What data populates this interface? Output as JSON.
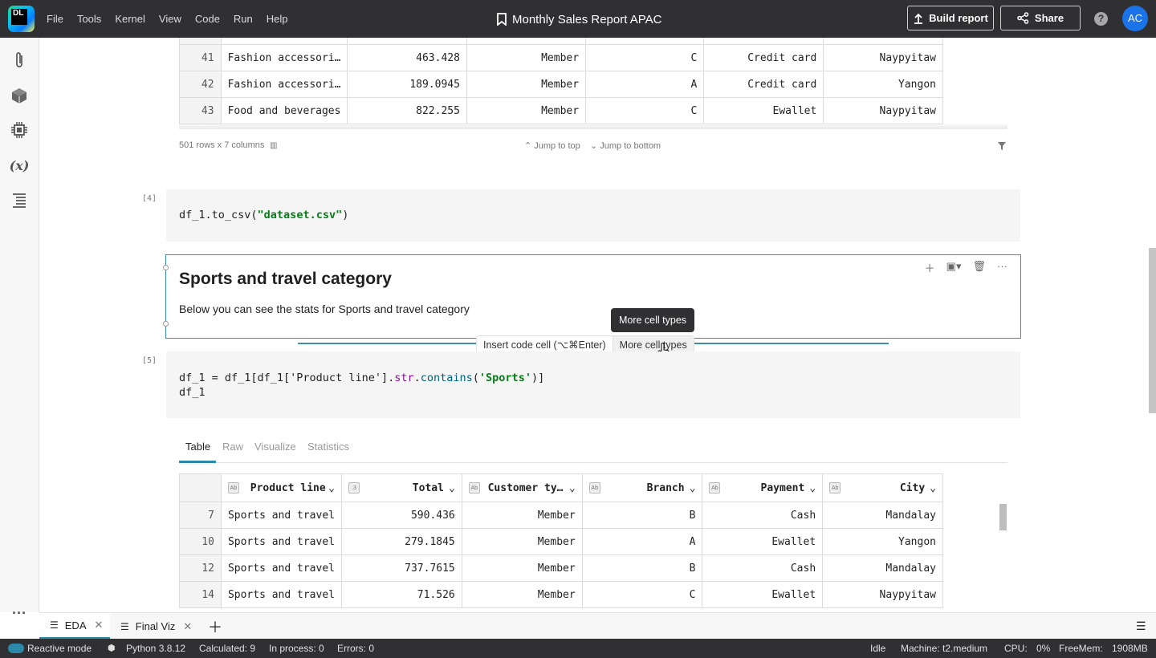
{
  "menu": [
    "File",
    "Tools",
    "Kernel",
    "View",
    "Code",
    "Run",
    "Help"
  ],
  "logo_text": "DL",
  "doc_title": "Monthly Sales Report APAC",
  "toolbar": {
    "build_label": "Build report",
    "share_label": "Share",
    "avatar": "AC",
    "help": "?"
  },
  "top_table": {
    "rows": [
      {
        "idx": "41",
        "product": "Fashion accessori…",
        "total": "463.428",
        "customer": "Member",
        "branch": "C",
        "payment": "Credit card",
        "city": "Naypyitaw"
      },
      {
        "idx": "42",
        "product": "Fashion accessori…",
        "total": "189.0945",
        "customer": "Member",
        "branch": "A",
        "payment": "Credit card",
        "city": "Yangon"
      },
      {
        "idx": "43",
        "product": "Food and beverages",
        "total": "822.255",
        "customer": "Member",
        "branch": "C",
        "payment": "Ewallet",
        "city": "Naypyitaw"
      }
    ],
    "summary": "501 rows x 7 columns",
    "jump_top": "Jump to top",
    "jump_bottom": "Jump to bottom"
  },
  "cell4": {
    "num": "[4]",
    "code_prefix": "df_1.to_csv(",
    "code_str": "\"dataset.csv\"",
    "code_suffix": ")"
  },
  "md_cell": {
    "heading": "Sports and travel category",
    "body": "Below you can see the stats for Sports and travel category"
  },
  "insert": {
    "code_label": "Insert code cell (⌥⌘Enter)",
    "more_label": "More cell types",
    "tooltip": "More cell types"
  },
  "cell5": {
    "num": "[5]",
    "line1_a": "df_1 = df_1[df_1['Product line'].",
    "line1_fn": "str",
    "line1_dot": ".",
    "line1_call": "contains",
    "line1_paren": "(",
    "line1_str": "'Sports'",
    "line1_end": ")]",
    "line2": "df_1"
  },
  "output_tabs": [
    "Table",
    "Raw",
    "Visualize",
    "Statistics"
  ],
  "bottom_table": {
    "headers": [
      {
        "type": "Ab",
        "label": "Product line"
      },
      {
        "type": ".3",
        "label": "Total"
      },
      {
        "type": "Ab",
        "label": "Customer ty…"
      },
      {
        "type": "Ab",
        "label": "Branch"
      },
      {
        "type": "Ab",
        "label": "Payment"
      },
      {
        "type": "Ab",
        "label": "City"
      }
    ],
    "rows": [
      {
        "idx": "7",
        "product": "Sports and travel",
        "total": "590.436",
        "customer": "Member",
        "branch": "B",
        "payment": "Cash",
        "city": "Mandalay"
      },
      {
        "idx": "10",
        "product": "Sports and travel",
        "total": "279.1845",
        "customer": "Member",
        "branch": "A",
        "payment": "Ewallet",
        "city": "Yangon"
      },
      {
        "idx": "12",
        "product": "Sports and travel",
        "total": "737.7615",
        "customer": "Member",
        "branch": "B",
        "payment": "Cash",
        "city": "Mandalay"
      },
      {
        "idx": "14",
        "product": "Sports and travel",
        "total": "71.526",
        "customer": "Member",
        "branch": "C",
        "payment": "Ewallet",
        "city": "Naypyitaw"
      }
    ]
  },
  "notebook_tabs": [
    {
      "label": "EDA",
      "active": true
    },
    {
      "label": "Final Viz",
      "active": false
    }
  ],
  "status": {
    "reactive": "Reactive mode",
    "python": "Python 3.8.12",
    "calculated": "Calculated: 9",
    "in_process": "In process: 0",
    "errors": "Errors: 0",
    "idle": "Idle",
    "machine": "Machine: t2.medium",
    "cpu_label": "CPU:",
    "cpu_value": "0%",
    "mem_label": "FreeMem:",
    "mem_value": "1908MB"
  },
  "colors": {
    "accent": "#2b8aa8",
    "topbar": "#303033",
    "avatar": "#1a73e8"
  }
}
